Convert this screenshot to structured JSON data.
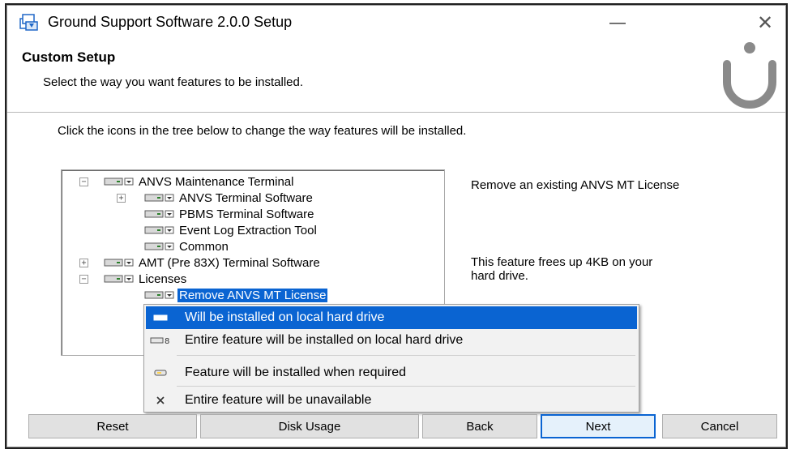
{
  "window": {
    "title": "Ground Support Software 2.0.0 Setup",
    "minimize_glyph": "—",
    "close_glyph": "✕"
  },
  "header": {
    "title": "Custom Setup",
    "subtitle": "Select the way you want features to be installed."
  },
  "instructions": "Click the icons in the tree below to change the way features will be installed.",
  "tree": {
    "items": [
      {
        "label": "ANVS Maintenance Terminal",
        "expander": "−",
        "depth": 0
      },
      {
        "label": "ANVS Terminal Software",
        "expander": "+",
        "depth": 1
      },
      {
        "label": "PBMS Terminal Software",
        "expander": "",
        "depth": 1
      },
      {
        "label": "Event Log Extraction Tool",
        "expander": "",
        "depth": 1
      },
      {
        "label": "Common",
        "expander": "",
        "depth": 1
      },
      {
        "label": "AMT (Pre 83X) Terminal Software",
        "expander": "+",
        "depth": 0
      },
      {
        "label": "Licenses",
        "expander": "−",
        "depth": 0
      },
      {
        "label": "Remove ANVS MT License",
        "expander": "",
        "depth": 1,
        "selected": true
      }
    ]
  },
  "description": {
    "feature": "Remove an existing ANVS MT License",
    "space_line1": "This feature frees up 4KB on your",
    "space_line2": "hard drive."
  },
  "context_menu": {
    "items": [
      {
        "label": "Will be installed on local hard drive",
        "icon": "drive-icon",
        "highlighted": true
      },
      {
        "label": "Entire feature will be installed on local hard drive",
        "icon": "drive-tree-icon"
      },
      {
        "label": "Feature will be installed when required",
        "icon": "drive-on-demand-icon"
      },
      {
        "label": "Entire feature will be unavailable",
        "icon": "unavailable-x-icon"
      }
    ]
  },
  "buttons": {
    "reset": "Reset",
    "disk_usage": "Disk Usage",
    "back": "Back",
    "next": "Next",
    "cancel": "Cancel"
  },
  "colors": {
    "selection": "#0a64d2",
    "button_face": "#e1e1e1",
    "logo_gray": "#8a8a8a"
  }
}
